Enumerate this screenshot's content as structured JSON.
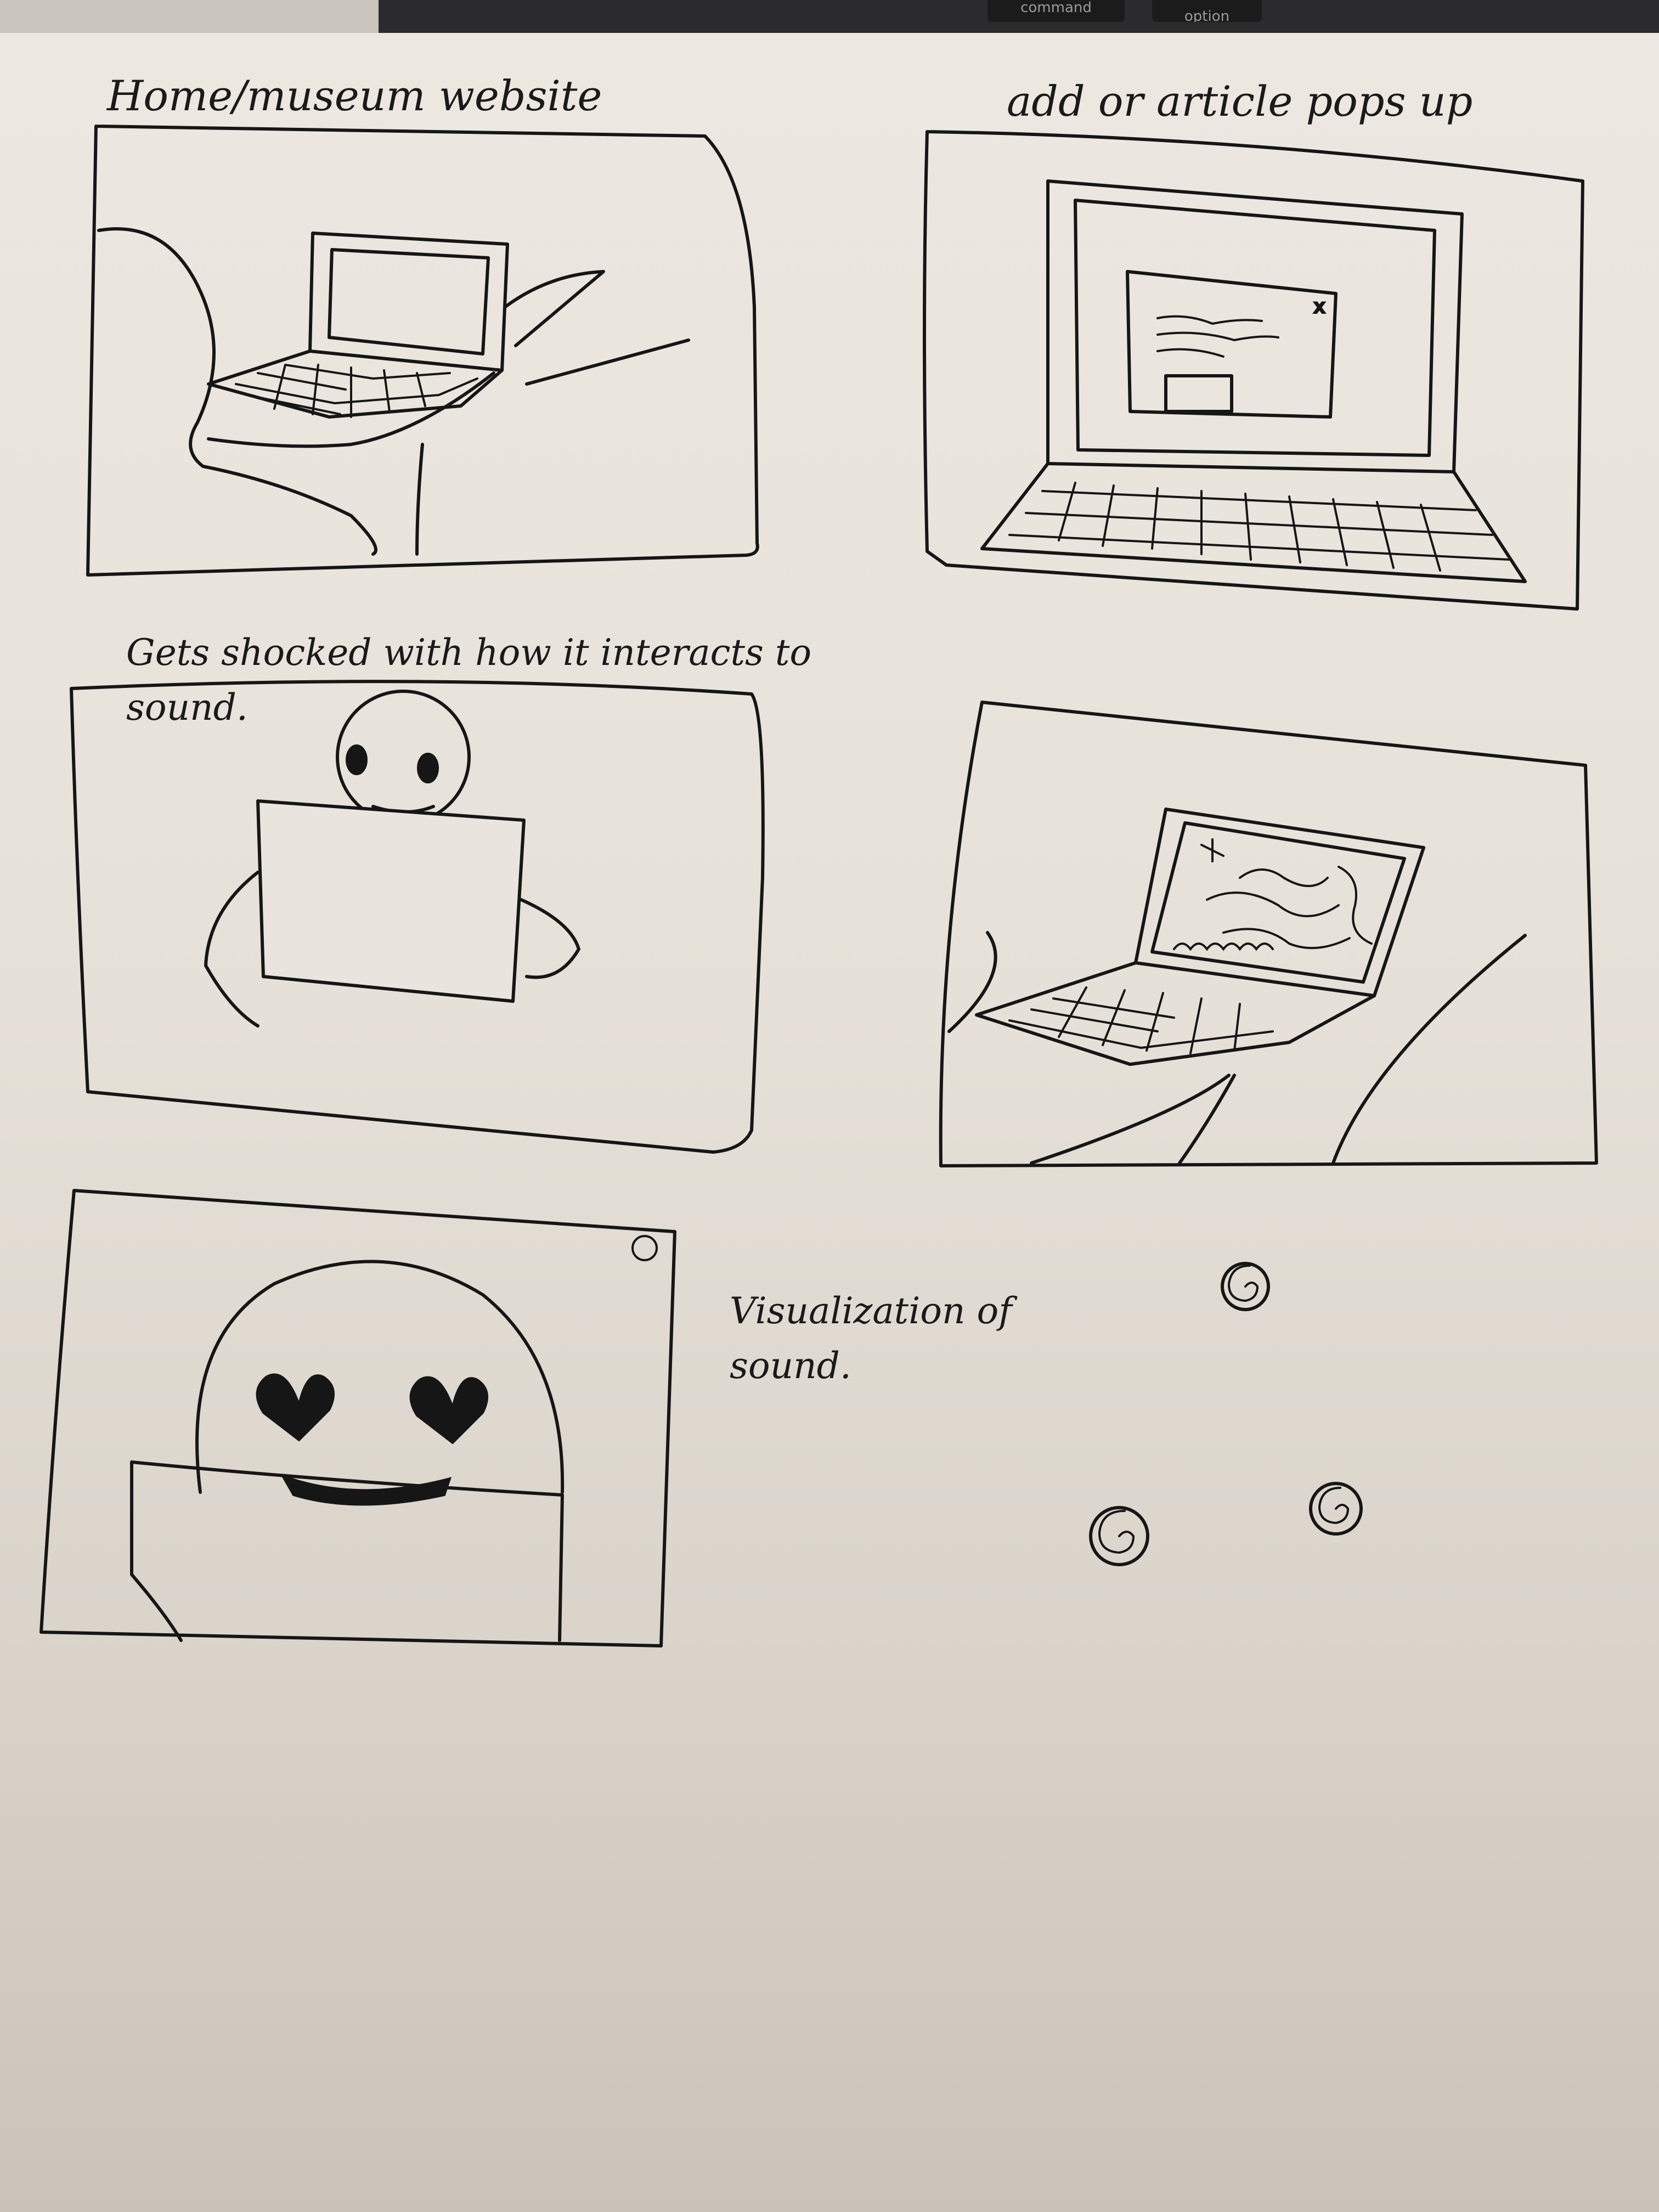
{
  "keyboard": {
    "command_key": "command",
    "option_key": "option"
  },
  "captions": {
    "panel1": "Home/museum website",
    "panel2": "add or article pops up",
    "panel3": "Gets shocked with how it interacts to sound.",
    "panel5": "Visualization of sound."
  },
  "popup_close": "x"
}
